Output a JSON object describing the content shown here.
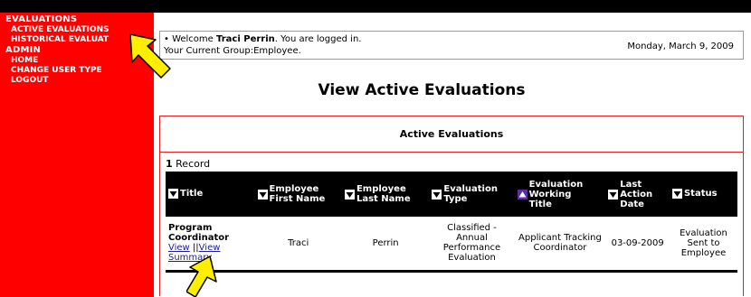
{
  "sidebar": {
    "sections": [
      {
        "label": "EVALUATIONS",
        "items": [
          "ACTIVE EVALUATIONS",
          "HISTORICAL EVALUAT"
        ]
      },
      {
        "label": "ADMIN",
        "items": [
          "HOME",
          "CHANGE USER TYPE",
          "LOGOUT"
        ]
      }
    ]
  },
  "welcome": {
    "prefix": "• Welcome ",
    "user": "Traci Perrin",
    "suffix": ". You are logged in.",
    "group": "Your Current Group:Employee.",
    "date": "Monday, March 9, 2009"
  },
  "page": {
    "title": "View Active Evaluations"
  },
  "panel": {
    "title": "Active Evaluations",
    "record_count": "1",
    "record_label": " Record",
    "columns": [
      {
        "label": "Title",
        "sort": "down"
      },
      {
        "label": "Employee First Name",
        "sort": "down"
      },
      {
        "label": "Employee Last Name",
        "sort": "down"
      },
      {
        "label": "Evaluation Type",
        "sort": "down"
      },
      {
        "label": "Evaluation Working Title",
        "sort": "up"
      },
      {
        "label": "Last Action Date",
        "sort": "down"
      },
      {
        "label": "Status",
        "sort": "down"
      }
    ],
    "rows": [
      {
        "title": "Program Coordinator",
        "view_link": "View",
        "separator": "||",
        "view_summary_link": "View Summary",
        "first_name": "Traci",
        "last_name": "Perrin",
        "eval_type": "Classified - Annual Performance Evaluation",
        "working_title": "Applicant Tracking Coordinator",
        "last_action_date": "03-09-2009",
        "status": "Evaluation Sent to Employee"
      }
    ]
  },
  "colors": {
    "sidebar": "#ff0000",
    "header_row": "#000000",
    "link": "#1a1aa6",
    "pointer": "#ffee00",
    "sort_up": "#5a2ea0"
  },
  "icons": [
    "sort-down-icon",
    "sort-up-icon",
    "pointer-arrow-icon"
  ]
}
